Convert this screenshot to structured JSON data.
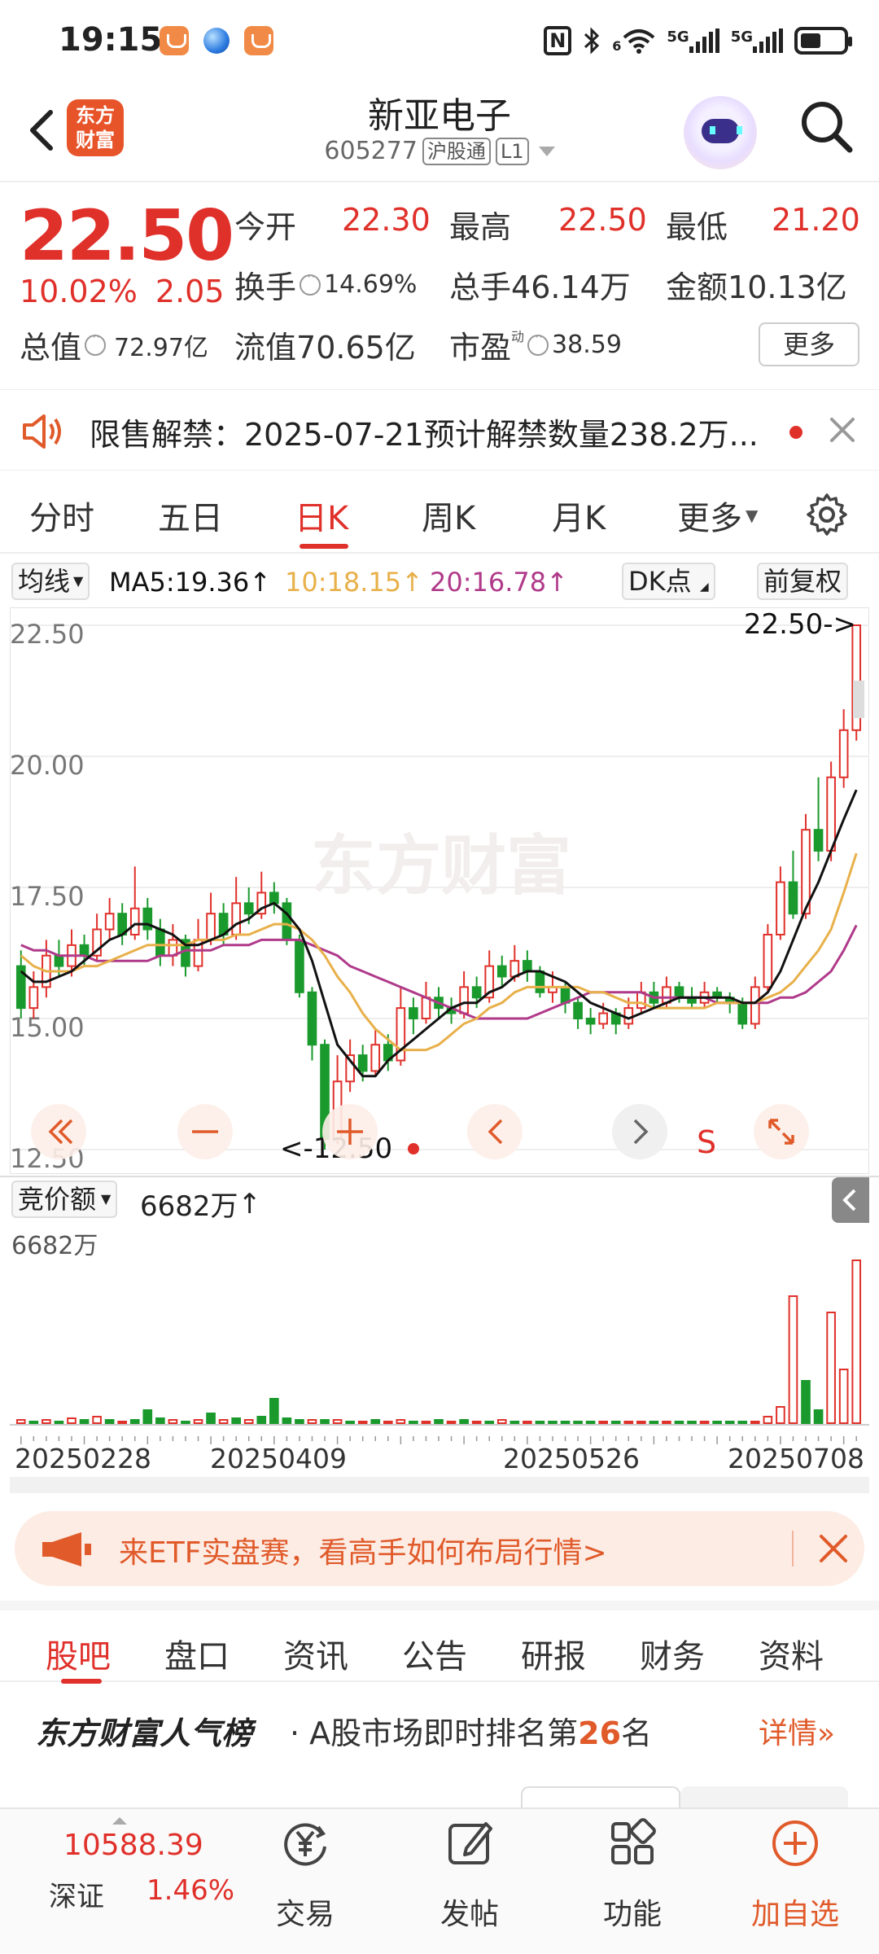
{
  "status_bar": {
    "time": "19:15",
    "net1": "5G",
    "net2": "5G",
    "wifi_num": "6"
  },
  "header": {
    "brand": [
      "东方",
      "财富"
    ],
    "stock_name": "新亚电子",
    "stock_code": "605277",
    "tag1": "沪股通",
    "tag2": "L1"
  },
  "quote": {
    "price": "22.50",
    "change_pct": "10.02%",
    "change_amt": "2.05",
    "open_label": "今开",
    "open": "22.30",
    "high_label": "最高",
    "high": "22.50",
    "low_label": "最低",
    "low": "21.20",
    "turnover_label": "换手",
    "turnover": "14.69%",
    "volume_label": "总手",
    "volume": "46.14万",
    "amount_label": "金额",
    "amount": "10.13亿",
    "mktcap_label": "总值",
    "mktcap": "72.97亿",
    "float_label": "流值",
    "float_cap": "70.65亿",
    "pe_label": "市盈",
    "pe_sup": "动",
    "pe": "38.59",
    "more": "更多"
  },
  "notice": {
    "text": "限售解禁：2025-07-21预计解禁数量238.2万..."
  },
  "tabs": [
    "分时",
    "五日",
    "日K",
    "周K",
    "月K",
    "更多"
  ],
  "active_tab": "日K",
  "ma_bar": {
    "selector": "均线",
    "ma5": "MA5:19.36↑",
    "ma10": "10:18.15↑",
    "ma20": "20:16.78↑",
    "dk": "DK点",
    "adjust": "前复权"
  },
  "colors": {
    "up": "#e0302a",
    "down": "#1a9a2c",
    "ma5": "#111111",
    "ma10": "#e8b04a",
    "ma20": "#b03a8a",
    "accent": "#e05a2a"
  },
  "chart_data": {
    "type": "candlestick",
    "y_ticks": [
      "22.50",
      "20.00",
      "17.50",
      "15.00",
      "12.50"
    ],
    "ylim": [
      12.5,
      22.5
    ],
    "max_label": "22.50->",
    "min_label": "<-12.50",
    "watermark": "东方财富",
    "s_marker": "S",
    "candles": [
      [
        16.0,
        15.2,
        16.3,
        15.0
      ],
      [
        15.2,
        15.6,
        15.9,
        15.0
      ],
      [
        15.6,
        16.2,
        16.5,
        15.4
      ],
      [
        16.2,
        16.0,
        16.5,
        15.8
      ],
      [
        16.0,
        16.4,
        16.7,
        15.8
      ],
      [
        16.4,
        16.2,
        16.6,
        16.0
      ],
      [
        16.2,
        16.7,
        17.0,
        16.1
      ],
      [
        16.7,
        17.0,
        17.3,
        16.5
      ],
      [
        17.0,
        16.6,
        17.2,
        16.4
      ],
      [
        16.6,
        17.1,
        17.9,
        16.5
      ],
      [
        17.1,
        16.7,
        17.3,
        16.5
      ],
      [
        16.7,
        16.2,
        16.9,
        16.0
      ],
      [
        16.2,
        16.5,
        16.8,
        16.0
      ],
      [
        16.5,
        16.0,
        16.6,
        15.8
      ],
      [
        16.0,
        16.5,
        16.9,
        15.9
      ],
      [
        16.5,
        17.0,
        17.4,
        16.4
      ],
      [
        17.0,
        16.6,
        17.2,
        16.4
      ],
      [
        16.6,
        17.2,
        17.7,
        16.5
      ],
      [
        17.2,
        17.0,
        17.5,
        16.8
      ],
      [
        17.0,
        17.4,
        17.8,
        16.9
      ],
      [
        17.4,
        17.2,
        17.6,
        17.0
      ],
      [
        17.2,
        16.5,
        17.3,
        16.4
      ],
      [
        16.5,
        15.5,
        16.6,
        15.4
      ],
      [
        15.5,
        14.5,
        15.6,
        14.2
      ],
      [
        14.5,
        12.7,
        14.6,
        12.5
      ],
      [
        12.7,
        13.8,
        14.3,
        12.6
      ],
      [
        13.8,
        14.3,
        14.6,
        13.6
      ],
      [
        14.3,
        14.0,
        14.5,
        13.8
      ],
      [
        14.0,
        14.5,
        14.8,
        13.9
      ],
      [
        14.5,
        14.2,
        14.7,
        14.0
      ],
      [
        14.2,
        15.2,
        15.6,
        14.1
      ],
      [
        15.2,
        15.0,
        15.4,
        14.7
      ],
      [
        15.0,
        15.4,
        15.7,
        14.9
      ],
      [
        15.4,
        15.2,
        15.6,
        15.0
      ],
      [
        15.2,
        15.1,
        15.4,
        14.9
      ],
      [
        15.1,
        15.6,
        15.9,
        15.0
      ],
      [
        15.6,
        15.4,
        15.8,
        15.2
      ],
      [
        15.4,
        16.0,
        16.3,
        15.3
      ],
      [
        16.0,
        15.8,
        16.2,
        15.6
      ],
      [
        15.8,
        16.1,
        16.4,
        15.7
      ],
      [
        16.1,
        15.9,
        16.3,
        15.7
      ],
      [
        15.9,
        15.5,
        16.0,
        15.4
      ],
      [
        15.5,
        15.6,
        15.9,
        15.3
      ],
      [
        15.6,
        15.3,
        15.7,
        15.1
      ],
      [
        15.3,
        15.0,
        15.4,
        14.8
      ],
      [
        15.0,
        14.9,
        15.2,
        14.7
      ],
      [
        14.9,
        15.1,
        15.3,
        14.8
      ],
      [
        15.1,
        14.9,
        15.2,
        14.7
      ],
      [
        14.9,
        15.2,
        15.4,
        14.8
      ],
      [
        15.2,
        15.5,
        15.7,
        15.1
      ],
      [
        15.5,
        15.3,
        15.7,
        15.2
      ],
      [
        15.3,
        15.6,
        15.8,
        15.2
      ],
      [
        15.6,
        15.4,
        15.7,
        15.3
      ],
      [
        15.4,
        15.3,
        15.6,
        15.2
      ],
      [
        15.3,
        15.5,
        15.7,
        15.2
      ],
      [
        15.5,
        15.4,
        15.6,
        15.3
      ],
      [
        15.4,
        15.3,
        15.5,
        15.1
      ],
      [
        15.3,
        14.9,
        15.4,
        14.8
      ],
      [
        14.9,
        15.6,
        15.8,
        14.8
      ],
      [
        15.6,
        16.6,
        16.8,
        15.5
      ],
      [
        16.6,
        17.6,
        17.9,
        16.5
      ],
      [
        17.6,
        17.0,
        18.2,
        16.9
      ],
      [
        17.0,
        18.6,
        18.9,
        16.9
      ],
      [
        18.6,
        18.2,
        19.6,
        18.0
      ],
      [
        18.2,
        19.6,
        19.9,
        18.0
      ],
      [
        19.6,
        20.5,
        20.9,
        19.4
      ],
      [
        20.5,
        22.5,
        22.5,
        20.3
      ]
    ],
    "ma5": [
      15.9,
      15.7,
      15.7,
      15.8,
      15.9,
      16.1,
      16.3,
      16.5,
      16.6,
      16.8,
      16.8,
      16.7,
      16.6,
      16.4,
      16.4,
      16.5,
      16.6,
      16.8,
      16.9,
      17.1,
      17.2,
      17.0,
      16.7,
      16.1,
      15.3,
      14.5,
      14.2,
      13.9,
      13.9,
      14.2,
      14.4,
      14.6,
      14.8,
      15.0,
      15.2,
      15.3,
      15.3,
      15.5,
      15.6,
      15.8,
      15.9,
      15.9,
      15.8,
      15.7,
      15.5,
      15.3,
      15.2,
      15.1,
      15.0,
      15.1,
      15.2,
      15.3,
      15.4,
      15.4,
      15.4,
      15.4,
      15.4,
      15.3,
      15.3,
      15.5,
      15.9,
      16.5,
      17.1,
      17.6,
      18.2,
      18.8,
      19.36
    ],
    "ma10": [
      16.2,
      16.0,
      15.9,
      15.9,
      15.9,
      16.0,
      16.0,
      16.1,
      16.2,
      16.3,
      16.4,
      16.4,
      16.4,
      16.4,
      16.5,
      16.5,
      16.5,
      16.6,
      16.6,
      16.7,
      16.8,
      16.8,
      16.7,
      16.5,
      16.2,
      15.8,
      15.5,
      15.1,
      14.8,
      14.6,
      14.4,
      14.4,
      14.4,
      14.5,
      14.7,
      14.9,
      15.0,
      15.2,
      15.3,
      15.5,
      15.6,
      15.6,
      15.6,
      15.6,
      15.6,
      15.5,
      15.5,
      15.4,
      15.3,
      15.3,
      15.2,
      15.2,
      15.2,
      15.2,
      15.2,
      15.3,
      15.3,
      15.3,
      15.3,
      15.4,
      15.5,
      15.7,
      16.0,
      16.3,
      16.7,
      17.4,
      18.15
    ],
    "ma20": [
      16.4,
      16.3,
      16.3,
      16.2,
      16.2,
      16.2,
      16.1,
      16.1,
      16.1,
      16.1,
      16.1,
      16.2,
      16.2,
      16.3,
      16.3,
      16.3,
      16.4,
      16.4,
      16.4,
      16.5,
      16.5,
      16.5,
      16.5,
      16.4,
      16.3,
      16.2,
      16.0,
      15.9,
      15.8,
      15.7,
      15.6,
      15.5,
      15.4,
      15.3,
      15.2,
      15.1,
      15.0,
      15.0,
      15.0,
      15.0,
      15.0,
      15.1,
      15.2,
      15.3,
      15.4,
      15.5,
      15.5,
      15.5,
      15.5,
      15.5,
      15.4,
      15.4,
      15.4,
      15.4,
      15.4,
      15.3,
      15.3,
      15.3,
      15.3,
      15.3,
      15.4,
      15.4,
      15.5,
      15.7,
      15.9,
      16.3,
      16.78
    ],
    "dates": [
      "20250228",
      "20250409",
      "20250526",
      "20250708"
    ],
    "volume": {
      "label": "竞价额",
      "value": "6682万",
      "max_label": "6682万",
      "bars": [
        0.02,
        0.01,
        0.02,
        0.01,
        0.03,
        0.02,
        0.04,
        0.02,
        0.01,
        0.02,
        0.08,
        0.03,
        0.02,
        0.01,
        0.02,
        0.06,
        0.02,
        0.03,
        0.02,
        0.04,
        0.15,
        0.03,
        0.02,
        0.02,
        0.02,
        0.02,
        0.01,
        0.01,
        0.02,
        0.01,
        0.02,
        0.01,
        0.01,
        0.02,
        0.01,
        0.02,
        0.01,
        0.01,
        0.02,
        0.01,
        0.01,
        0.01,
        0.01,
        0.01,
        0.01,
        0.01,
        0.01,
        0.01,
        0.01,
        0.01,
        0.01,
        0.01,
        0.01,
        0.01,
        0.01,
        0.01,
        0.01,
        0.01,
        0.01,
        0.04,
        0.1,
        0.78,
        0.26,
        0.08,
        0.68,
        0.33,
        1.0
      ],
      "bar_up": [
        1,
        0,
        1,
        0,
        1,
        0,
        1,
        0,
        1,
        0,
        0,
        0,
        1,
        0,
        1,
        0,
        1,
        0,
        1,
        0,
        0,
        0,
        0,
        1,
        0,
        1,
        0,
        1,
        0,
        1,
        1,
        0,
        1,
        0,
        1,
        0,
        1,
        0,
        1,
        0,
        1,
        0,
        0,
        0,
        0,
        0,
        1,
        0,
        1,
        1,
        0,
        1,
        0,
        0,
        1,
        0,
        0,
        0,
        1,
        1,
        1,
        1,
        0,
        0,
        1,
        1,
        1
      ]
    }
  },
  "banner": {
    "text": "来ETF实盘赛，看高手如何布局行情>"
  },
  "section_tabs": [
    "股吧",
    "盘口",
    "资讯",
    "公告",
    "研报",
    "财务",
    "资料"
  ],
  "rank": {
    "title": "东方财富人气榜",
    "prefix": "· A股市场即时排名第",
    "num": "26",
    "suffix": "名",
    "link": "详情»"
  },
  "bottom_nav": {
    "index_value": "10588.39",
    "index_name": "深证",
    "index_pct": "1.46%",
    "trade": "交易",
    "post": "发帖",
    "func": "功能",
    "watch": "加自选"
  }
}
